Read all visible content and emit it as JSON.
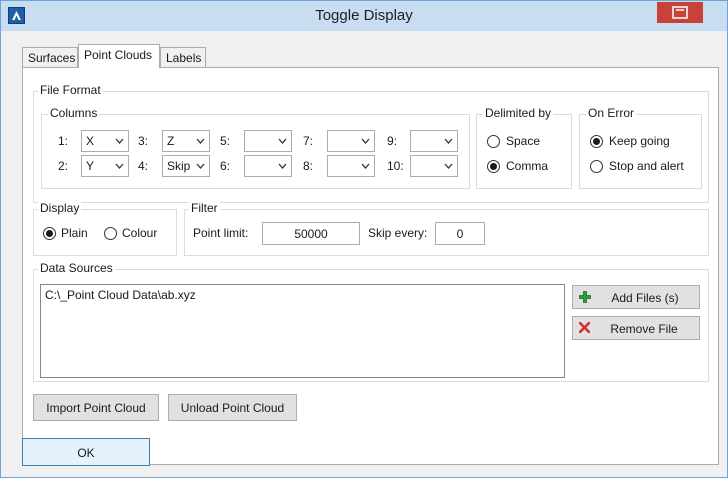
{
  "window": {
    "title": "Toggle Display",
    "app_icon": "app-logo-icon",
    "close_icon": "close-icon"
  },
  "tabs": [
    {
      "label": "Surfaces",
      "active": false
    },
    {
      "label": "Point Clouds",
      "active": true
    },
    {
      "label": "Labels",
      "active": false
    }
  ],
  "file_format": {
    "title": "File Format",
    "columns": {
      "title": "Columns",
      "items": [
        {
          "label": "1:",
          "value": "X"
        },
        {
          "label": "2:",
          "value": "Y"
        },
        {
          "label": "3:",
          "value": "Z"
        },
        {
          "label": "4:",
          "value": "Skip"
        },
        {
          "label": "5:",
          "value": ""
        },
        {
          "label": "6:",
          "value": ""
        },
        {
          "label": "7:",
          "value": ""
        },
        {
          "label": "8:",
          "value": ""
        },
        {
          "label": "9:",
          "value": ""
        },
        {
          "label": "10:",
          "value": ""
        }
      ]
    },
    "delimited_by": {
      "title": "Delimited by",
      "options": [
        {
          "label": "Space",
          "selected": false
        },
        {
          "label": "Comma",
          "selected": true
        }
      ]
    },
    "on_error": {
      "title": "On Error",
      "options": [
        {
          "label": "Keep going",
          "selected": true
        },
        {
          "label": "Stop and alert",
          "selected": false
        }
      ]
    }
  },
  "display": {
    "title": "Display",
    "options": [
      {
        "label": "Plain",
        "selected": true
      },
      {
        "label": "Colour",
        "selected": false
      }
    ]
  },
  "filter": {
    "title": "Filter",
    "point_limit_label": "Point limit:",
    "point_limit_value": "50000",
    "skip_every_label": "Skip every:",
    "skip_every_value": "0"
  },
  "data_sources": {
    "title": "Data Sources",
    "files": [
      "C:\\_Point Cloud Data\\ab.xyz"
    ],
    "add_files_label": "Add Files (s)",
    "add_icon": "plus-icon",
    "remove_file_label": "Remove File",
    "remove_icon": "red-x-icon"
  },
  "buttons": {
    "import": "Import Point Cloud",
    "unload": "Unload Point Cloud",
    "ok": "OK"
  },
  "colors": {
    "titlebar": "#c8dcf2",
    "close": "#c7433a",
    "add_green": "#2e9b3a",
    "remove_red": "#d0312d",
    "ok_border": "#3c7fb1"
  }
}
